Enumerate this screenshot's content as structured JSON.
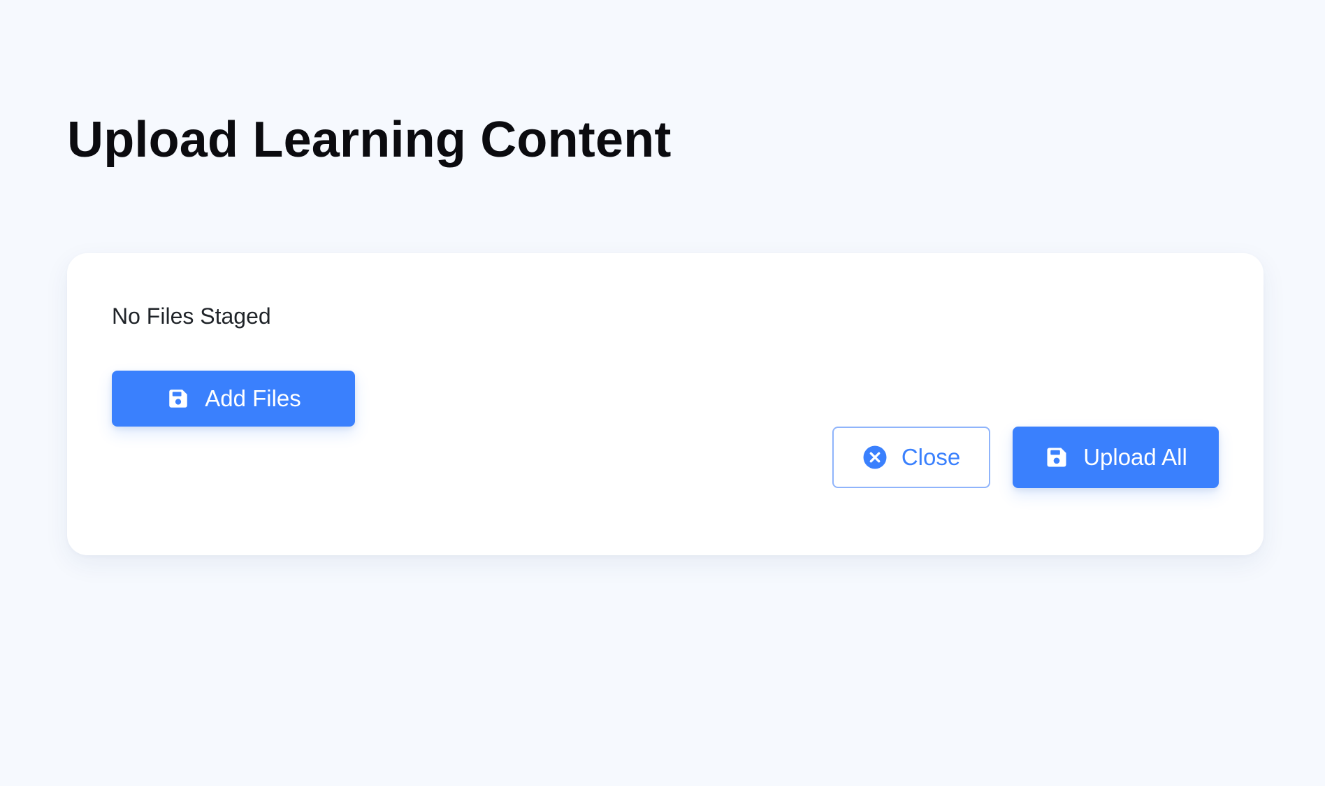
{
  "page": {
    "title": "Upload Learning Content"
  },
  "staging": {
    "empty_message": "No Files Staged",
    "add_files_label": "Add Files",
    "add_files_icon": "save-icon"
  },
  "actions": {
    "close_label": "Close",
    "close_icon": "close-circle-icon",
    "upload_all_label": "Upload All",
    "upload_all_icon": "save-icon"
  },
  "colors": {
    "accent": "#3a80fd",
    "outline_border": "#8fb4fb",
    "background": "#f6f9fe",
    "card": "#ffffff",
    "title_text": "#0b0b0f"
  }
}
